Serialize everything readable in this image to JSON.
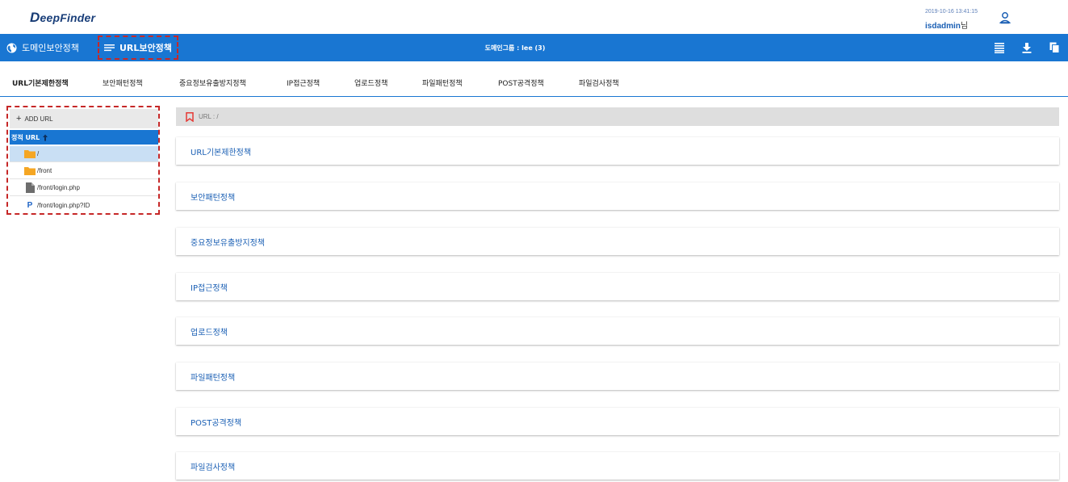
{
  "header": {
    "logo_first": "D",
    "logo_rest": "eepFinder",
    "datetime": "2019-10-16 13:41:15",
    "username": "isdadmin",
    "username_suffix": "님",
    "user_icon": "user-icon"
  },
  "navbar": {
    "domain_policy_label": "도메인보안정책",
    "url_policy_label": "URL보안정책",
    "domain_group_label": "도메인그룹 : lee (3)",
    "tool_icons": [
      "list-icon",
      "download-icon",
      "copy-icon"
    ]
  },
  "tabs": [
    {
      "label": "URL기본제한정책"
    },
    {
      "label": "보안패턴정책"
    },
    {
      "label": "중요정보유출방지정책"
    },
    {
      "label": "IP접근정책"
    },
    {
      "label": "업로드정책"
    },
    {
      "label": "파일패턴정책"
    },
    {
      "label": "POST공격정책"
    },
    {
      "label": "파일검사정책"
    }
  ],
  "left_panel": {
    "add_url_label": "ADD URL",
    "tree_header": "정적 URL",
    "items": [
      {
        "label": "/",
        "icon": "folder-icon"
      },
      {
        "label": "/front",
        "icon": "folder-icon"
      },
      {
        "label": "/front/login.php",
        "icon": "file-icon"
      },
      {
        "label": "/front/login.php?ID",
        "icon": "parameter-icon"
      }
    ]
  },
  "main": {
    "path_label": "URL : /",
    "sections": [
      {
        "label": "URL기본제한정책"
      },
      {
        "label": "보안패턴정책"
      },
      {
        "label": "중요정보유출방지정책"
      },
      {
        "label": "IP접근정책"
      },
      {
        "label": "업로드정책"
      },
      {
        "label": "파일패턴정책"
      },
      {
        "label": "POST공격정책"
      },
      {
        "label": "파일검사정책"
      }
    ]
  },
  "colors": {
    "primary": "#1976d2",
    "highlight_dashed": "#c62828",
    "folder": "#f5a623",
    "selected_row": "#c9dff4"
  }
}
